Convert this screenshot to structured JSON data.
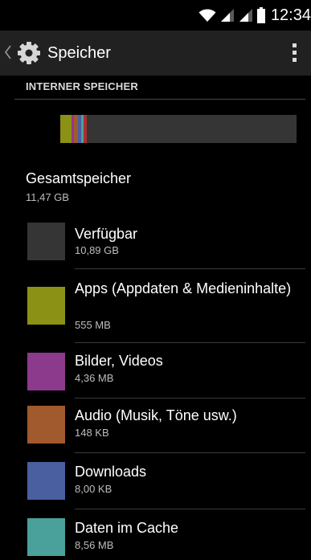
{
  "status_bar": {
    "time": "12:34",
    "icons": [
      "wifi-icon",
      "signal-icon",
      "signal-icon",
      "battery-icon"
    ]
  },
  "action_bar": {
    "title": "Speicher",
    "icon": "settings-gear-icon",
    "menu_icon": "overflow-menu-icon"
  },
  "section": {
    "header": "INTERNER SPEICHER"
  },
  "usage_bar": {
    "background_color": "#353535",
    "segments": [
      {
        "name": "apps",
        "color": "#8b9114",
        "fraction": 0.047
      },
      {
        "name": "images",
        "color": "#8c3a8c",
        "fraction": 0.012
      },
      {
        "name": "audio",
        "color": "#a05a2d",
        "fraction": 0.016
      },
      {
        "name": "downloads",
        "color": "#4a5fa0",
        "fraction": 0.012
      },
      {
        "name": "cache",
        "color": "#4aa09a",
        "fraction": 0.012
      },
      {
        "name": "misc",
        "color": "#a82f2f",
        "fraction": 0.012
      }
    ]
  },
  "total": {
    "title": "Gesamtspeicher",
    "value": "11,47 GB"
  },
  "items": [
    {
      "label": "Verfügbar",
      "value": "10,89 GB",
      "color": "#353535"
    },
    {
      "label": "Apps (Appdaten & Medieninhalte)",
      "value": "555 MB",
      "color": "#8b9114"
    },
    {
      "label": "Bilder, Videos",
      "value": "4,36 MB",
      "color": "#8c3a8c"
    },
    {
      "label": "Audio (Musik, Töne usw.)",
      "value": "148 KB",
      "color": "#a05a2d"
    },
    {
      "label": "Downloads",
      "value": "8,00 KB",
      "color": "#4a5fa0"
    },
    {
      "label": "Daten im Cache",
      "value": "8,56 MB",
      "color": "#4aa09a"
    }
  ]
}
